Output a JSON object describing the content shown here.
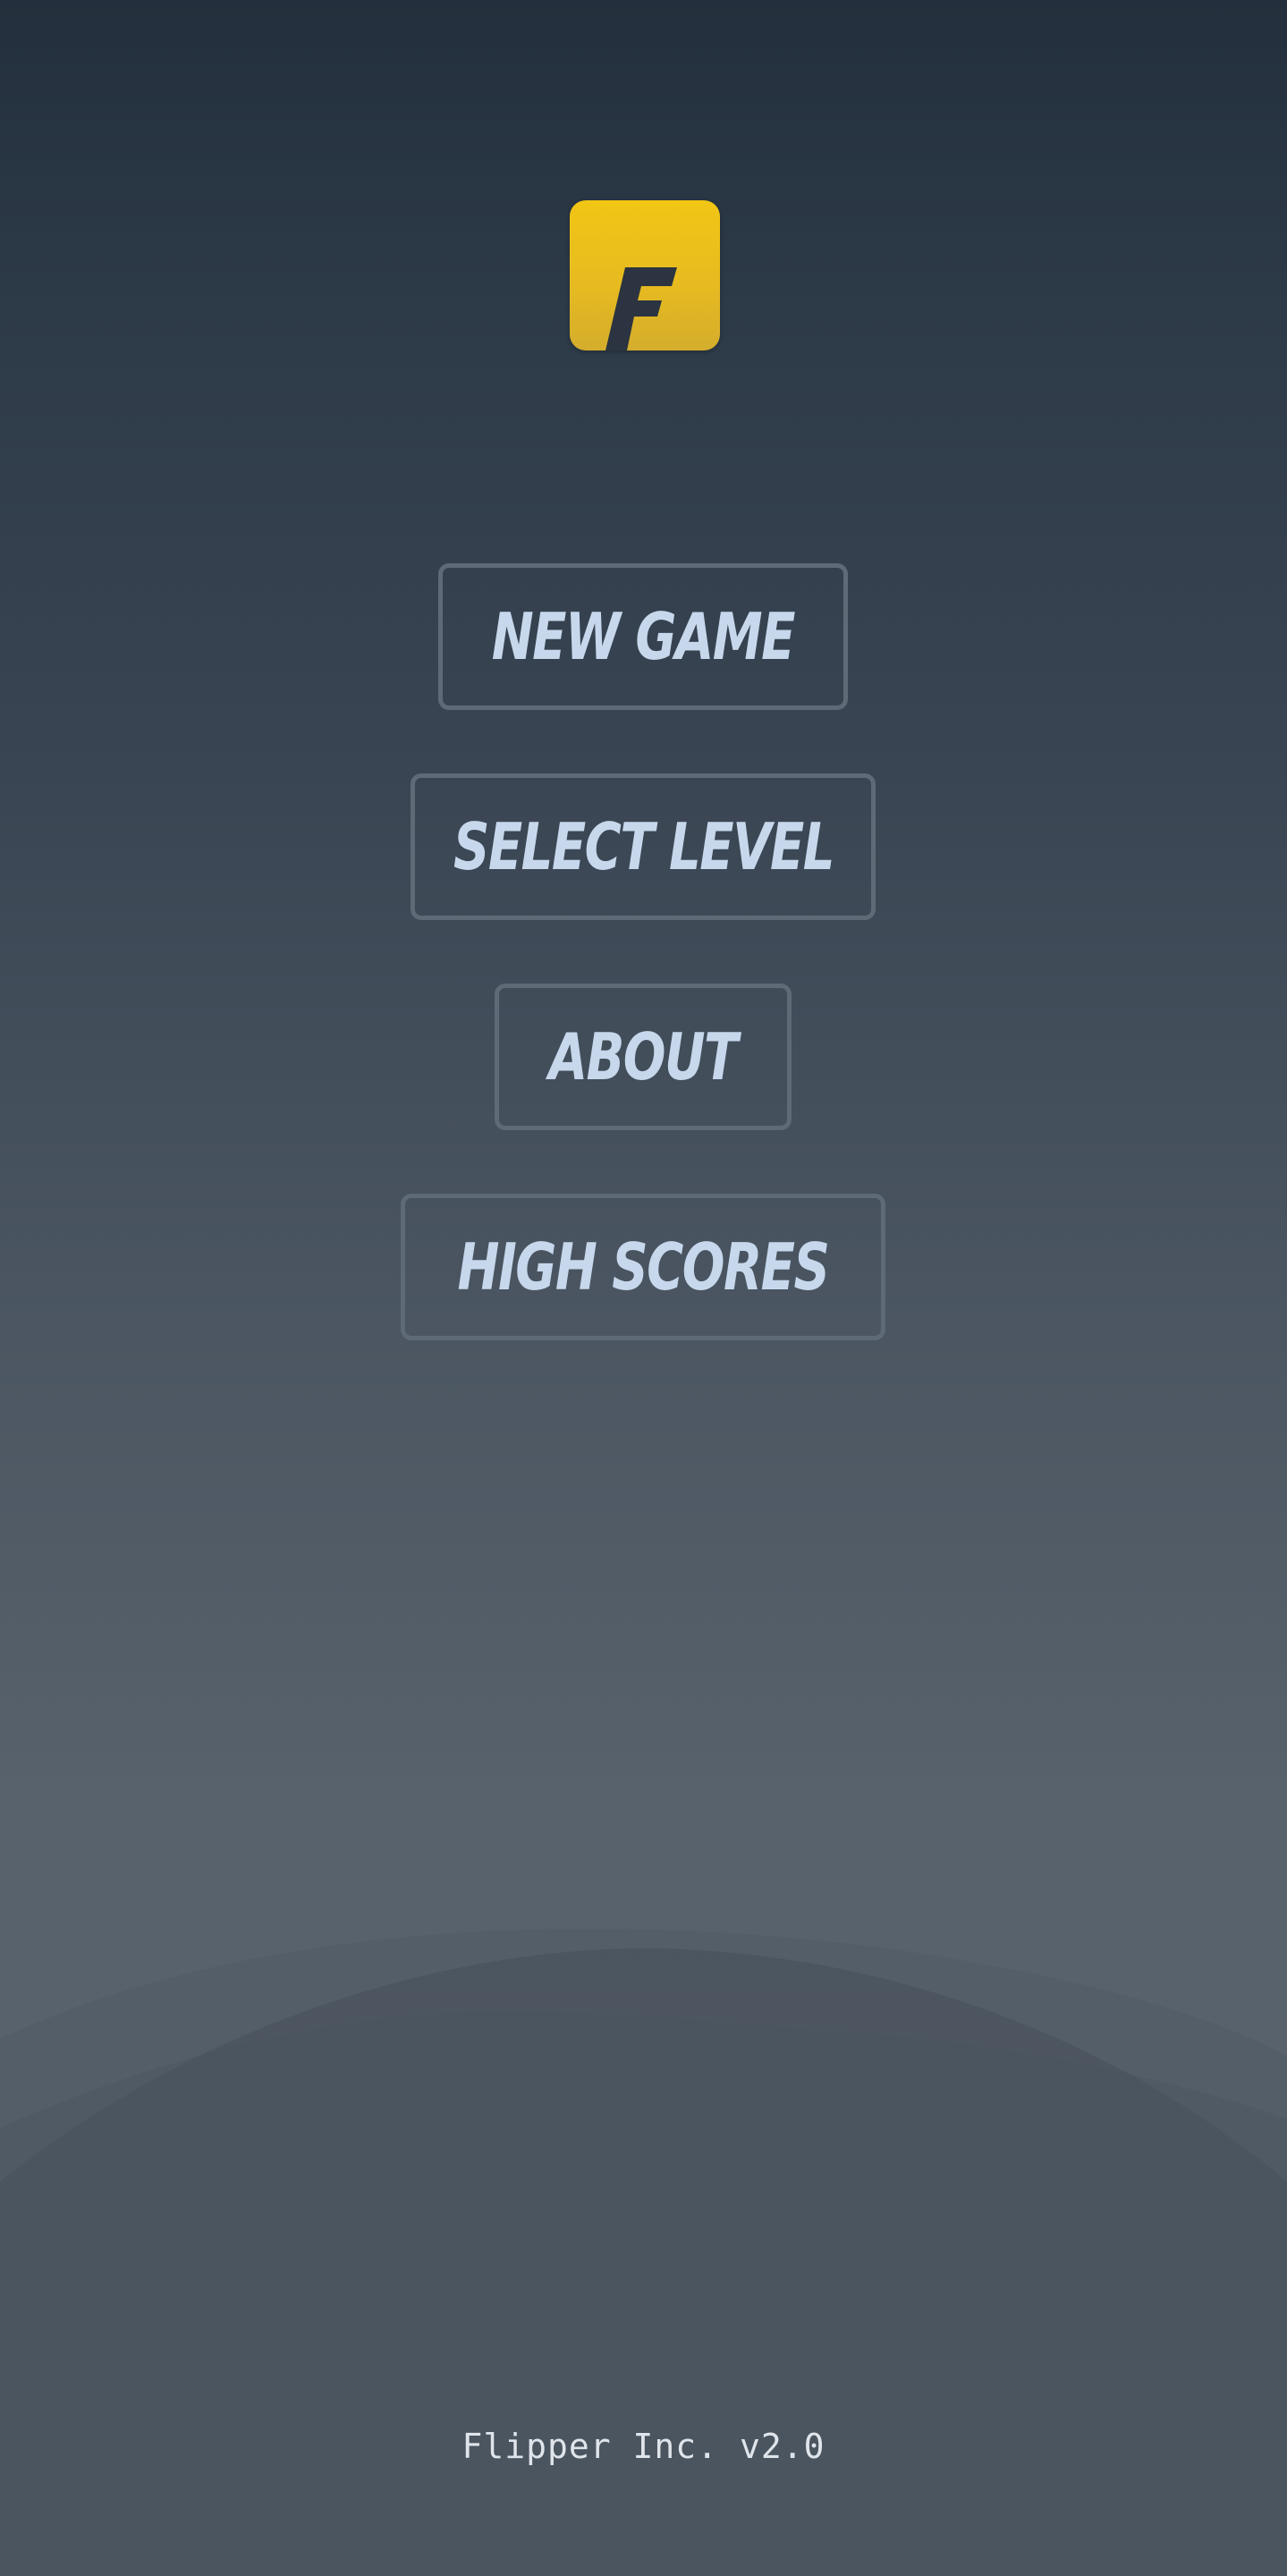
{
  "logo": {
    "letter": "F",
    "color": "#f2c614"
  },
  "menu": {
    "items": [
      {
        "label": "New Game"
      },
      {
        "label": "Select Level"
      },
      {
        "label": "About"
      },
      {
        "label": "High Scores"
      }
    ]
  },
  "footer": {
    "text": "Flipper Inc. v2.0"
  },
  "colors": {
    "background_top": "#232f3c",
    "background_bottom": "#5a636c",
    "button_border": "#5e6a76",
    "button_text": "#c7d8ec",
    "footer_text": "#dfe5ea"
  }
}
